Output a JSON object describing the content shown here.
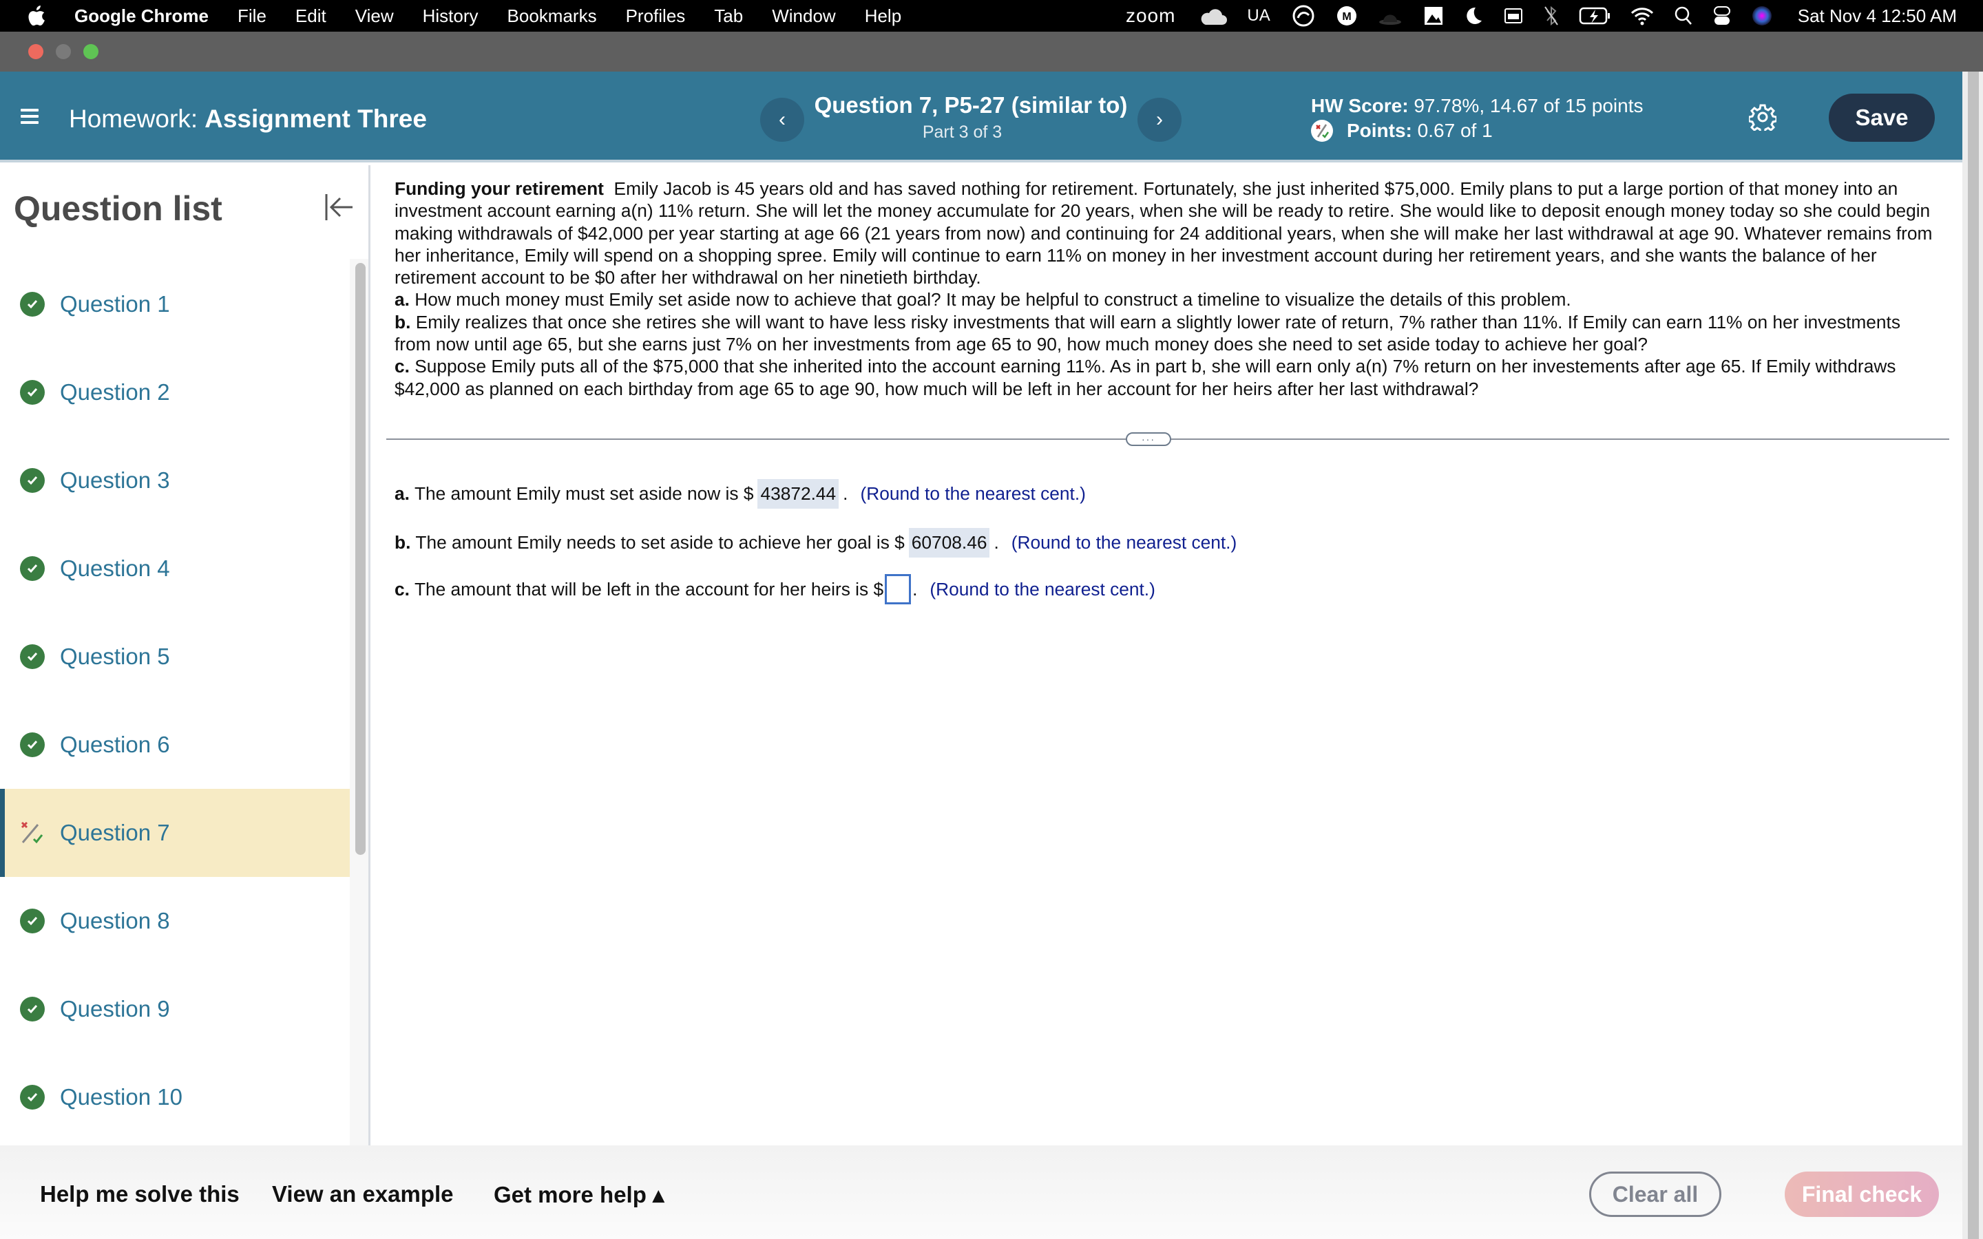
{
  "menubar": {
    "app_name": "Google Chrome",
    "items": [
      "File",
      "Edit",
      "View",
      "History",
      "Bookmarks",
      "Profiles",
      "Tab",
      "Window",
      "Help"
    ],
    "status_zoom": "zoom",
    "status_ua": "UA",
    "clock": "Sat Nov 4  12:50 AM"
  },
  "header": {
    "homework_label": "Homework:",
    "assignment_title": "Assignment Three",
    "question_title": "Question 7, P5-27 (similar to)",
    "question_part": "Part 3 of 3",
    "hw_score_label": "HW Score:",
    "hw_score_value": "97.78%, 14.67 of 15 points",
    "points_label": "Points:",
    "points_value": "0.67 of 1",
    "save_label": "Save"
  },
  "sidebar": {
    "title": "Question list",
    "items": [
      {
        "label": "Question 1",
        "status": "correct"
      },
      {
        "label": "Question 2",
        "status": "correct"
      },
      {
        "label": "Question 3",
        "status": "correct"
      },
      {
        "label": "Question 4",
        "status": "correct"
      },
      {
        "label": "Question 5",
        "status": "correct"
      },
      {
        "label": "Question 6",
        "status": "correct"
      },
      {
        "label": "Question 7",
        "status": "partial",
        "active": true
      },
      {
        "label": "Question 8",
        "status": "correct"
      },
      {
        "label": "Question 9",
        "status": "correct"
      },
      {
        "label": "Question 10",
        "status": "correct"
      }
    ]
  },
  "problem": {
    "title": "Funding your retirement",
    "body": "Emily Jacob is 45 years old and has saved nothing for retirement. Fortunately, she just inherited $75,000. Emily plans to put a large portion of that money into an investment account earning a(n) 11% return. She will let the money accumulate for 20 years, when she will be ready to retire. She would like to deposit enough money today so she could begin making withdrawals of $42,000 per year starting at age 66 (21 years from now) and continuing for 24 additional years, when she will make her last withdrawal at age 90. Whatever remains from her inheritance, Emily will spend on a shopping spree. Emily will continue to earn 11% on money in her investment account during her retirement years, and she wants the balance of her retirement account to be $0 after her withdrawal on her ninetieth birthday.",
    "part_a_label": "a.",
    "part_a": "How much money must Emily set aside now to achieve that goal? It may be helpful to construct a timeline to visualize the details of this problem.",
    "part_b_label": "b.",
    "part_b": "Emily realizes that once she retires she will want to have less risky investments that will earn a slightly lower rate of return, 7% rather than 11%. If Emily can earn 11% on her investments from now until age 65, but she earns just 7% on her investments from age 65 to 90, how much money does she need to set aside today to achieve her goal?",
    "part_c_label": "c.",
    "part_c": "Suppose Emily puts all of the $75,000 that she inherited into the account earning 11%. As in part b, she will earn only a(n) 7% return on her investements after age 65. If Emily withdraws $42,000 as planned on each birthday from age 65 to age 90, how much will be left in her account for her heirs after her last withdrawal?"
  },
  "answers": {
    "a": {
      "label": "a.",
      "text": "The amount Emily must set aside now is $",
      "value": "43872.44",
      "suffix": ".",
      "hint": "(Round to the nearest cent.)"
    },
    "b": {
      "label": "b.",
      "text": "The amount Emily needs to set aside to achieve her goal is $",
      "value": "60708.46",
      "suffix": ".",
      "hint": "(Round to the nearest cent.)"
    },
    "c": {
      "label": "c.",
      "text": "The amount that will be left in the account for her heirs is $",
      "value": "",
      "suffix": ".",
      "hint": "(Round to the nearest cent.)"
    }
  },
  "expand_label": "···",
  "bottom": {
    "help_me_solve": "Help me solve this",
    "view_example": "View an example",
    "get_more_help": "Get more help ▴",
    "clear_all": "Clear all",
    "final_check": "Final check"
  },
  "colors": {
    "header_bg": "#337795",
    "save_bg": "#22344a",
    "link_blue": "#2d7597",
    "correct_green": "#3a7d42",
    "active_row_bg": "#f7ebc5",
    "hint_blue": "#0f1f8f"
  }
}
